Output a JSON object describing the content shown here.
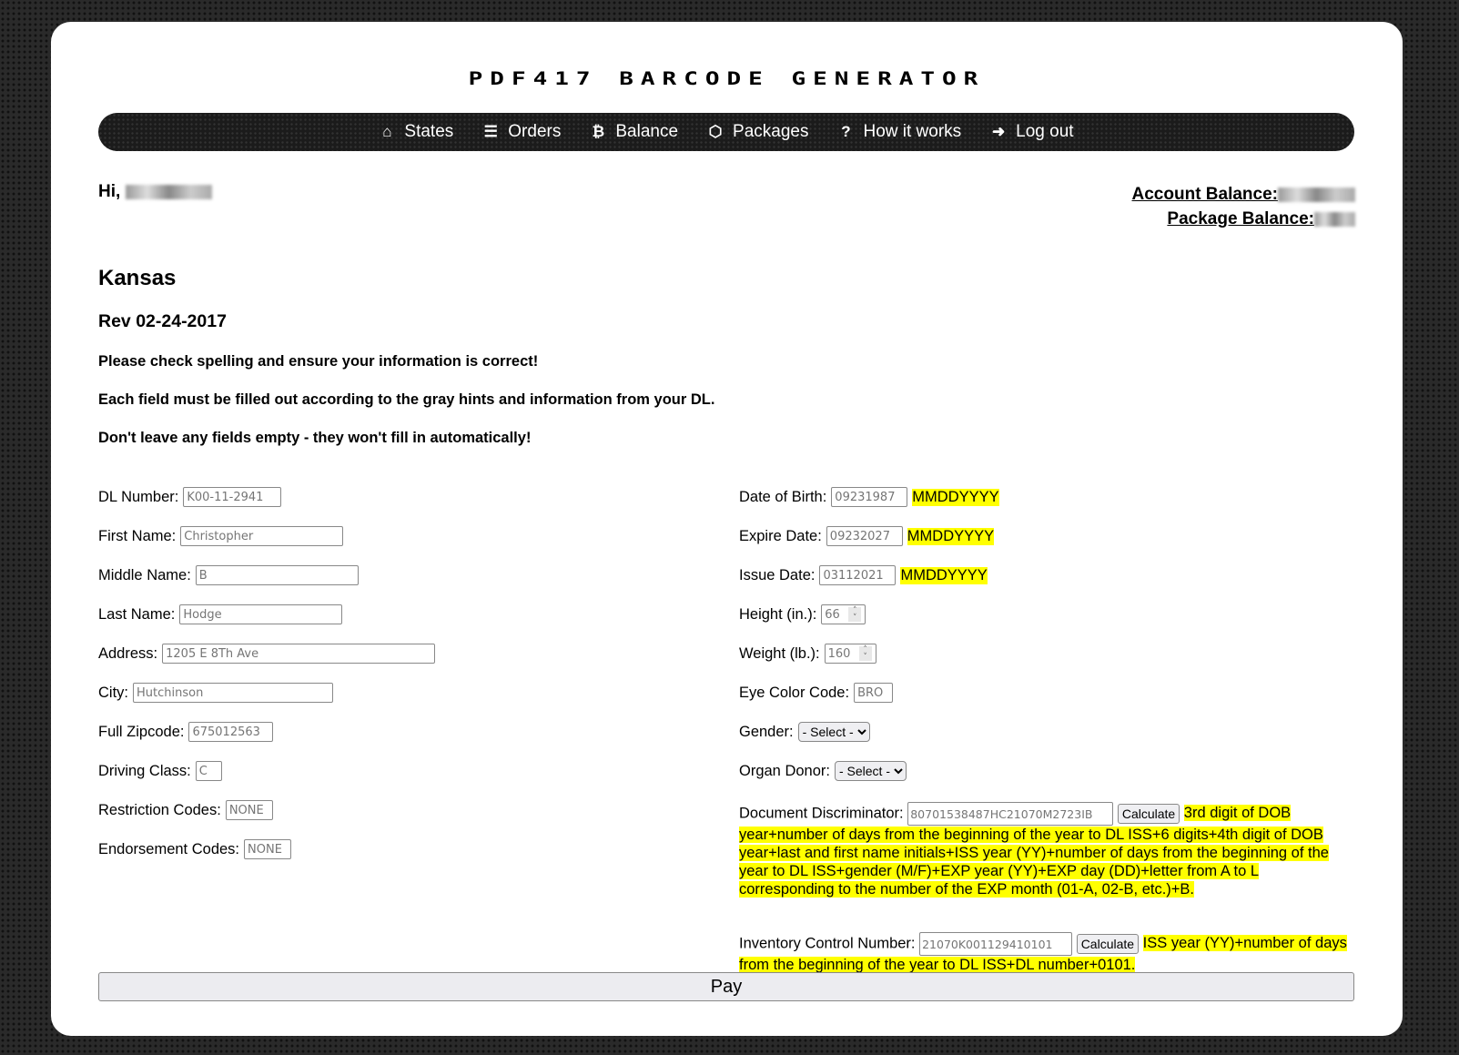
{
  "app_title": "PDF417 BARCODE GENERATOR",
  "nav": [
    {
      "icon": "home-icon",
      "glyph": "⌂",
      "label": "States"
    },
    {
      "icon": "list-icon",
      "glyph": "☰",
      "label": "Orders"
    },
    {
      "icon": "bitcoin-icon",
      "glyph": "₿",
      "label": "Balance"
    },
    {
      "icon": "cube-icon",
      "glyph": "⬡",
      "label": "Packages"
    },
    {
      "icon": "question-icon",
      "glyph": "?",
      "label": "How it works"
    },
    {
      "icon": "logout-icon",
      "glyph": "➜",
      "label": "Log out"
    }
  ],
  "greeting": "Hi,",
  "account_balance_label": "Account Balance:",
  "package_balance_label": "Package Balance:",
  "state": "Kansas",
  "revision": "Rev 02-24-2017",
  "notes": [
    "Please check spelling and ensure your information is correct!",
    "Each field must be filled out according to the gray hints and information from your DL.",
    "Don't leave any fields empty - they won't fill in automatically!"
  ],
  "left_fields": [
    {
      "label": "DL Number:",
      "placeholder": "K00-11-2941"
    },
    {
      "label": "First Name:",
      "placeholder": "Christopher"
    },
    {
      "label": "Middle Name:",
      "placeholder": "B"
    },
    {
      "label": "Last Name:",
      "placeholder": "Hodge"
    },
    {
      "label": "Address:",
      "placeholder": "1205 E 8Th Ave"
    },
    {
      "label": "City:",
      "placeholder": "Hutchinson"
    },
    {
      "label": "Full Zipcode:",
      "placeholder": "675012563"
    },
    {
      "label": "Driving Class:",
      "placeholder": "C"
    },
    {
      "label": "Restriction Codes:",
      "placeholder": "NONE"
    },
    {
      "label": "Endorsement Codes:",
      "placeholder": "NONE"
    }
  ],
  "right_fields": {
    "dob": {
      "label": "Date of Birth:",
      "placeholder": "09231987",
      "hint": "MMDDYYYY"
    },
    "exp": {
      "label": "Expire Date:",
      "placeholder": "09232027",
      "hint": "MMDDYYYY"
    },
    "iss": {
      "label": "Issue Date:",
      "placeholder": "03112021",
      "hint": "MMDDYYYY"
    },
    "height": {
      "label": "Height (in.):",
      "placeholder": "66"
    },
    "weight": {
      "label": "Weight (lb.):",
      "placeholder": "160"
    },
    "eye": {
      "label": "Eye Color Code:",
      "placeholder": "BRO"
    },
    "gender": {
      "label": "Gender:",
      "selected": "- Select -"
    },
    "donor": {
      "label": "Organ Donor:",
      "selected": "- Select -"
    },
    "dd": {
      "label": "Document Discriminator:",
      "placeholder": "80701538487HC21070M2723IB",
      "button": "Calculate",
      "hint": "3rd digit of DOB year+number of days from the beginning of the year to DL ISS+6 digits+4th digit of DOB year+last and first name initials+ISS year (YY)+number of days from the beginning of the year to DL ISS+gender (M/F)+EXP year (YY)+EXP day (DD)+letter from A to L corresponding to the number of the EXP month (01-A, 02-B, etc.)+B."
    },
    "icn": {
      "label": "Inventory Control Number:",
      "placeholder": "21070K001129410101",
      "button": "Calculate",
      "hint": "ISS year (YY)+number of days from the beginning of the year to DL ISS+DL number+0101."
    }
  },
  "pay_label": "Pay",
  "colors": {
    "highlight": "#ffff00",
    "nav_bg": "#1b1b1b"
  }
}
